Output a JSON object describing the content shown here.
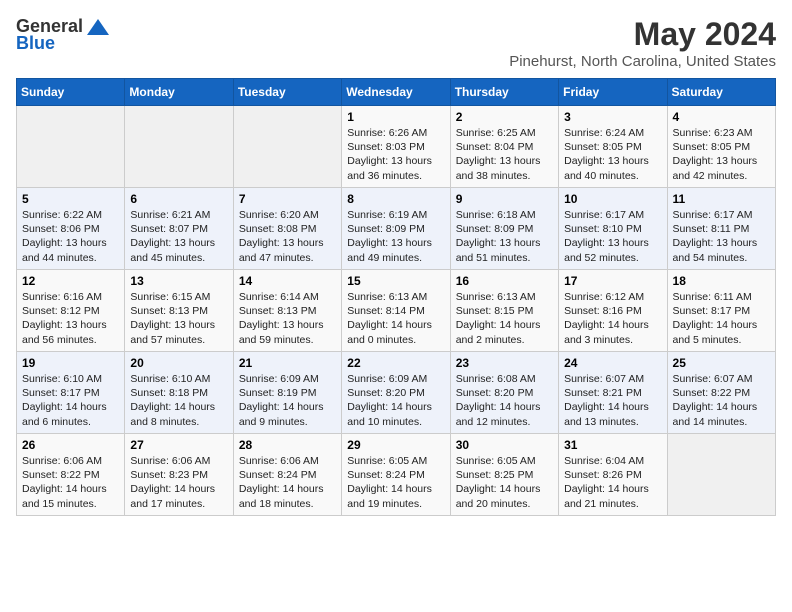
{
  "header": {
    "logo_general": "General",
    "logo_blue": "Blue",
    "month_title": "May 2024",
    "location": "Pinehurst, North Carolina, United States"
  },
  "days_of_week": [
    "Sunday",
    "Monday",
    "Tuesday",
    "Wednesday",
    "Thursday",
    "Friday",
    "Saturday"
  ],
  "weeks": [
    [
      {
        "day": "",
        "info": ""
      },
      {
        "day": "",
        "info": ""
      },
      {
        "day": "",
        "info": ""
      },
      {
        "day": "1",
        "info": "Sunrise: 6:26 AM\nSunset: 8:03 PM\nDaylight: 13 hours\nand 36 minutes."
      },
      {
        "day": "2",
        "info": "Sunrise: 6:25 AM\nSunset: 8:04 PM\nDaylight: 13 hours\nand 38 minutes."
      },
      {
        "day": "3",
        "info": "Sunrise: 6:24 AM\nSunset: 8:05 PM\nDaylight: 13 hours\nand 40 minutes."
      },
      {
        "day": "4",
        "info": "Sunrise: 6:23 AM\nSunset: 8:05 PM\nDaylight: 13 hours\nand 42 minutes."
      }
    ],
    [
      {
        "day": "5",
        "info": "Sunrise: 6:22 AM\nSunset: 8:06 PM\nDaylight: 13 hours\nand 44 minutes."
      },
      {
        "day": "6",
        "info": "Sunrise: 6:21 AM\nSunset: 8:07 PM\nDaylight: 13 hours\nand 45 minutes."
      },
      {
        "day": "7",
        "info": "Sunrise: 6:20 AM\nSunset: 8:08 PM\nDaylight: 13 hours\nand 47 minutes."
      },
      {
        "day": "8",
        "info": "Sunrise: 6:19 AM\nSunset: 8:09 PM\nDaylight: 13 hours\nand 49 minutes."
      },
      {
        "day": "9",
        "info": "Sunrise: 6:18 AM\nSunset: 8:09 PM\nDaylight: 13 hours\nand 51 minutes."
      },
      {
        "day": "10",
        "info": "Sunrise: 6:17 AM\nSunset: 8:10 PM\nDaylight: 13 hours\nand 52 minutes."
      },
      {
        "day": "11",
        "info": "Sunrise: 6:17 AM\nSunset: 8:11 PM\nDaylight: 13 hours\nand 54 minutes."
      }
    ],
    [
      {
        "day": "12",
        "info": "Sunrise: 6:16 AM\nSunset: 8:12 PM\nDaylight: 13 hours\nand 56 minutes."
      },
      {
        "day": "13",
        "info": "Sunrise: 6:15 AM\nSunset: 8:13 PM\nDaylight: 13 hours\nand 57 minutes."
      },
      {
        "day": "14",
        "info": "Sunrise: 6:14 AM\nSunset: 8:13 PM\nDaylight: 13 hours\nand 59 minutes."
      },
      {
        "day": "15",
        "info": "Sunrise: 6:13 AM\nSunset: 8:14 PM\nDaylight: 14 hours\nand 0 minutes."
      },
      {
        "day": "16",
        "info": "Sunrise: 6:13 AM\nSunset: 8:15 PM\nDaylight: 14 hours\nand 2 minutes."
      },
      {
        "day": "17",
        "info": "Sunrise: 6:12 AM\nSunset: 8:16 PM\nDaylight: 14 hours\nand 3 minutes."
      },
      {
        "day": "18",
        "info": "Sunrise: 6:11 AM\nSunset: 8:17 PM\nDaylight: 14 hours\nand 5 minutes."
      }
    ],
    [
      {
        "day": "19",
        "info": "Sunrise: 6:10 AM\nSunset: 8:17 PM\nDaylight: 14 hours\nand 6 minutes."
      },
      {
        "day": "20",
        "info": "Sunrise: 6:10 AM\nSunset: 8:18 PM\nDaylight: 14 hours\nand 8 minutes."
      },
      {
        "day": "21",
        "info": "Sunrise: 6:09 AM\nSunset: 8:19 PM\nDaylight: 14 hours\nand 9 minutes."
      },
      {
        "day": "22",
        "info": "Sunrise: 6:09 AM\nSunset: 8:20 PM\nDaylight: 14 hours\nand 10 minutes."
      },
      {
        "day": "23",
        "info": "Sunrise: 6:08 AM\nSunset: 8:20 PM\nDaylight: 14 hours\nand 12 minutes."
      },
      {
        "day": "24",
        "info": "Sunrise: 6:07 AM\nSunset: 8:21 PM\nDaylight: 14 hours\nand 13 minutes."
      },
      {
        "day": "25",
        "info": "Sunrise: 6:07 AM\nSunset: 8:22 PM\nDaylight: 14 hours\nand 14 minutes."
      }
    ],
    [
      {
        "day": "26",
        "info": "Sunrise: 6:06 AM\nSunset: 8:22 PM\nDaylight: 14 hours\nand 15 minutes."
      },
      {
        "day": "27",
        "info": "Sunrise: 6:06 AM\nSunset: 8:23 PM\nDaylight: 14 hours\nand 17 minutes."
      },
      {
        "day": "28",
        "info": "Sunrise: 6:06 AM\nSunset: 8:24 PM\nDaylight: 14 hours\nand 18 minutes."
      },
      {
        "day": "29",
        "info": "Sunrise: 6:05 AM\nSunset: 8:24 PM\nDaylight: 14 hours\nand 19 minutes."
      },
      {
        "day": "30",
        "info": "Sunrise: 6:05 AM\nSunset: 8:25 PM\nDaylight: 14 hours\nand 20 minutes."
      },
      {
        "day": "31",
        "info": "Sunrise: 6:04 AM\nSunset: 8:26 PM\nDaylight: 14 hours\nand 21 minutes."
      },
      {
        "day": "",
        "info": ""
      }
    ]
  ]
}
